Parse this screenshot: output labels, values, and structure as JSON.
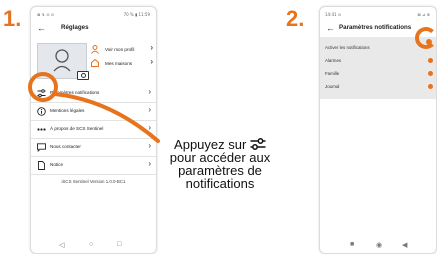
{
  "step1": {
    "number": "1.",
    "status_left": "⊠ ↯ ⊙ ⊙",
    "status_right": "70 % ▮ 11:59",
    "title": "Réglages",
    "profile_link": "Voir mon profil",
    "homes_link": "Mes maisons",
    "menu": [
      {
        "label": "Paramètres notifications",
        "icon": "sliders-icon"
      },
      {
        "label": "Mentions légales",
        "icon": "info-icon"
      },
      {
        "label": "À propos de SCS Sentinel",
        "icon": "dots-icon"
      },
      {
        "label": "Nous contacter",
        "icon": "chat-icon"
      },
      {
        "label": "Notice",
        "icon": "document-icon"
      }
    ],
    "version": "iSCS Sentinel Version 1.0.0-BC1"
  },
  "caption": {
    "before_icon": "Appuyez sur",
    "after_icon": "pour accéder aux paramètres de notifications"
  },
  "step2": {
    "number": "2.",
    "status_left": "14:41 ⊙",
    "status_right": "⊠ ⊿ ⊚",
    "title": "Paramètres notifications",
    "items": [
      {
        "label": "Activer les notifications",
        "enabled": true
      },
      {
        "label": "Alarmes",
        "enabled": true
      },
      {
        "label": "Famille",
        "enabled": true
      },
      {
        "label": "Journal",
        "enabled": true
      }
    ]
  },
  "colors": {
    "accent": "#e8731d",
    "text": "#111111",
    "row_bg": "#e9e9e9"
  }
}
